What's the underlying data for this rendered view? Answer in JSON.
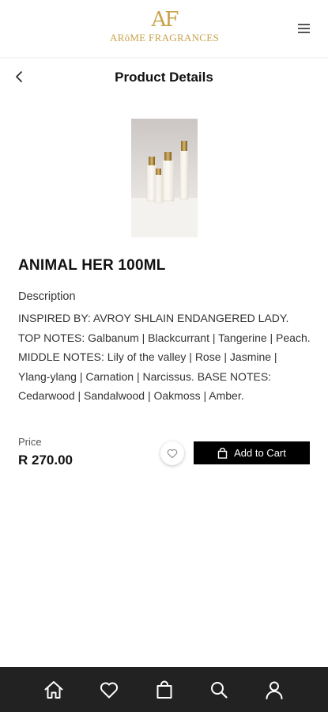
{
  "header": {
    "logo_mark": "AF",
    "logo_text": "ARôME FRAGRANCES",
    "brand_color": "#c9a24a"
  },
  "subheader": {
    "title": "Product Details"
  },
  "product": {
    "name": "ANIMAL HER 100ML",
    "description_heading": "Description",
    "description": "INSPIRED BY: AVROY SHLAIN ENDANGERED LADY. TOP NOTES: Galbanum | Blackcurrant | Tangerine | Peach. MIDDLE NOTES: Lily of the valley | Rose | Jasmine | Ylang-ylang | Carnation | Narcissus. BASE NOTES: Cedarwood | Sandalwood | Oakmoss | Amber.",
    "price_label": "Price",
    "price": "R 270.00",
    "add_to_cart_label": "Add to Cart"
  },
  "bottom_nav": {
    "items": [
      {
        "icon": "home-icon"
      },
      {
        "icon": "heart-icon"
      },
      {
        "icon": "shopping-bag-icon"
      },
      {
        "icon": "search-icon"
      },
      {
        "icon": "user-icon"
      }
    ],
    "background": "#222222"
  }
}
